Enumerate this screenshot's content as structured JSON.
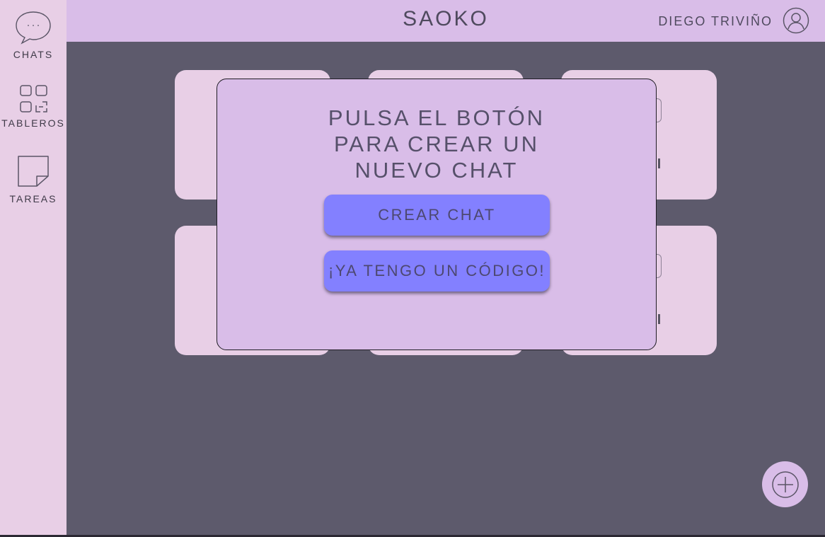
{
  "app": {
    "title": "SAOKO"
  },
  "user": {
    "name": "DIEGO TRIVIÑO",
    "icon": "user-circle-icon"
  },
  "sidebar": {
    "items": [
      {
        "label": "CHATS",
        "icon": "chat-bubble-icon"
      },
      {
        "label": "TABLEROS",
        "icon": "boards-grid-icon"
      },
      {
        "label": "TAREAS",
        "icon": "sticky-note-icon"
      }
    ]
  },
  "modal": {
    "title": "PULSA EL BOTÓN\nPARA CREAR UN\nNUEVO CHAT",
    "create_label": "CREAR CHAT",
    "code_label": "¡YA TENGO UN CÓDIGO!"
  },
  "fab": {
    "icon": "plus-icon"
  },
  "colors": {
    "background": "#5d5a6c",
    "sidebar": "#e8cfe6",
    "topbar": "#d9bde8",
    "modal": "#d9bde8",
    "button": "#8380ff",
    "card": "#e8cfe6"
  }
}
